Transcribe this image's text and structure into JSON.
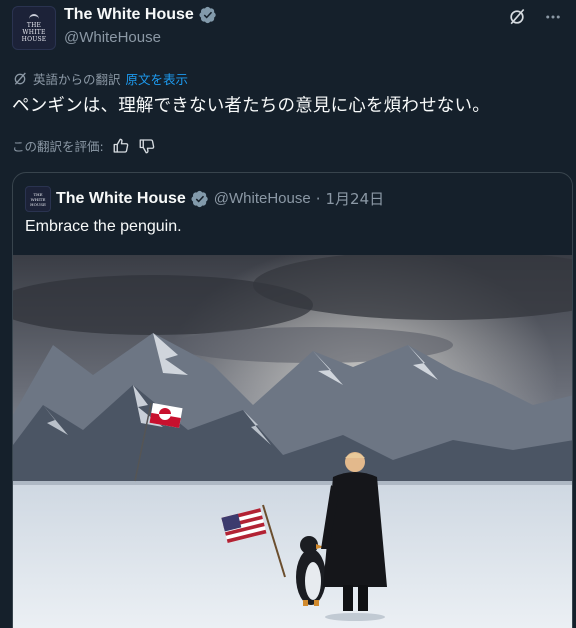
{
  "tweet": {
    "author": {
      "name": "The White House",
      "handle": "@WhiteHouse",
      "avatar_text": "THE\nWHITE\nHOUSE",
      "verified_badge_color": "#829aab"
    },
    "translated_label": "英語からの翻訳",
    "show_original_label": "原文を表示",
    "text": "ペンギンは、理解できない者たちの意見に心を煩わせない。",
    "rate_translation_label": "この翻訳を評価:",
    "icons": [
      "grok-icon",
      "more-icon",
      "translate-icon",
      "thumbs-up-icon",
      "thumbs-down-icon"
    ]
  },
  "quote": {
    "author": {
      "name": "The White House",
      "handle": "@WhiteHouse",
      "avatar_text": "THE\nWHITE\nHOUSE"
    },
    "separator": "·",
    "date": "1月24日",
    "text": "Embrace the penguin."
  },
  "colors": {
    "background": "#15202b",
    "link": "#1d9bf0",
    "secondary_text": "#8b98a5",
    "border": "#38444d"
  }
}
